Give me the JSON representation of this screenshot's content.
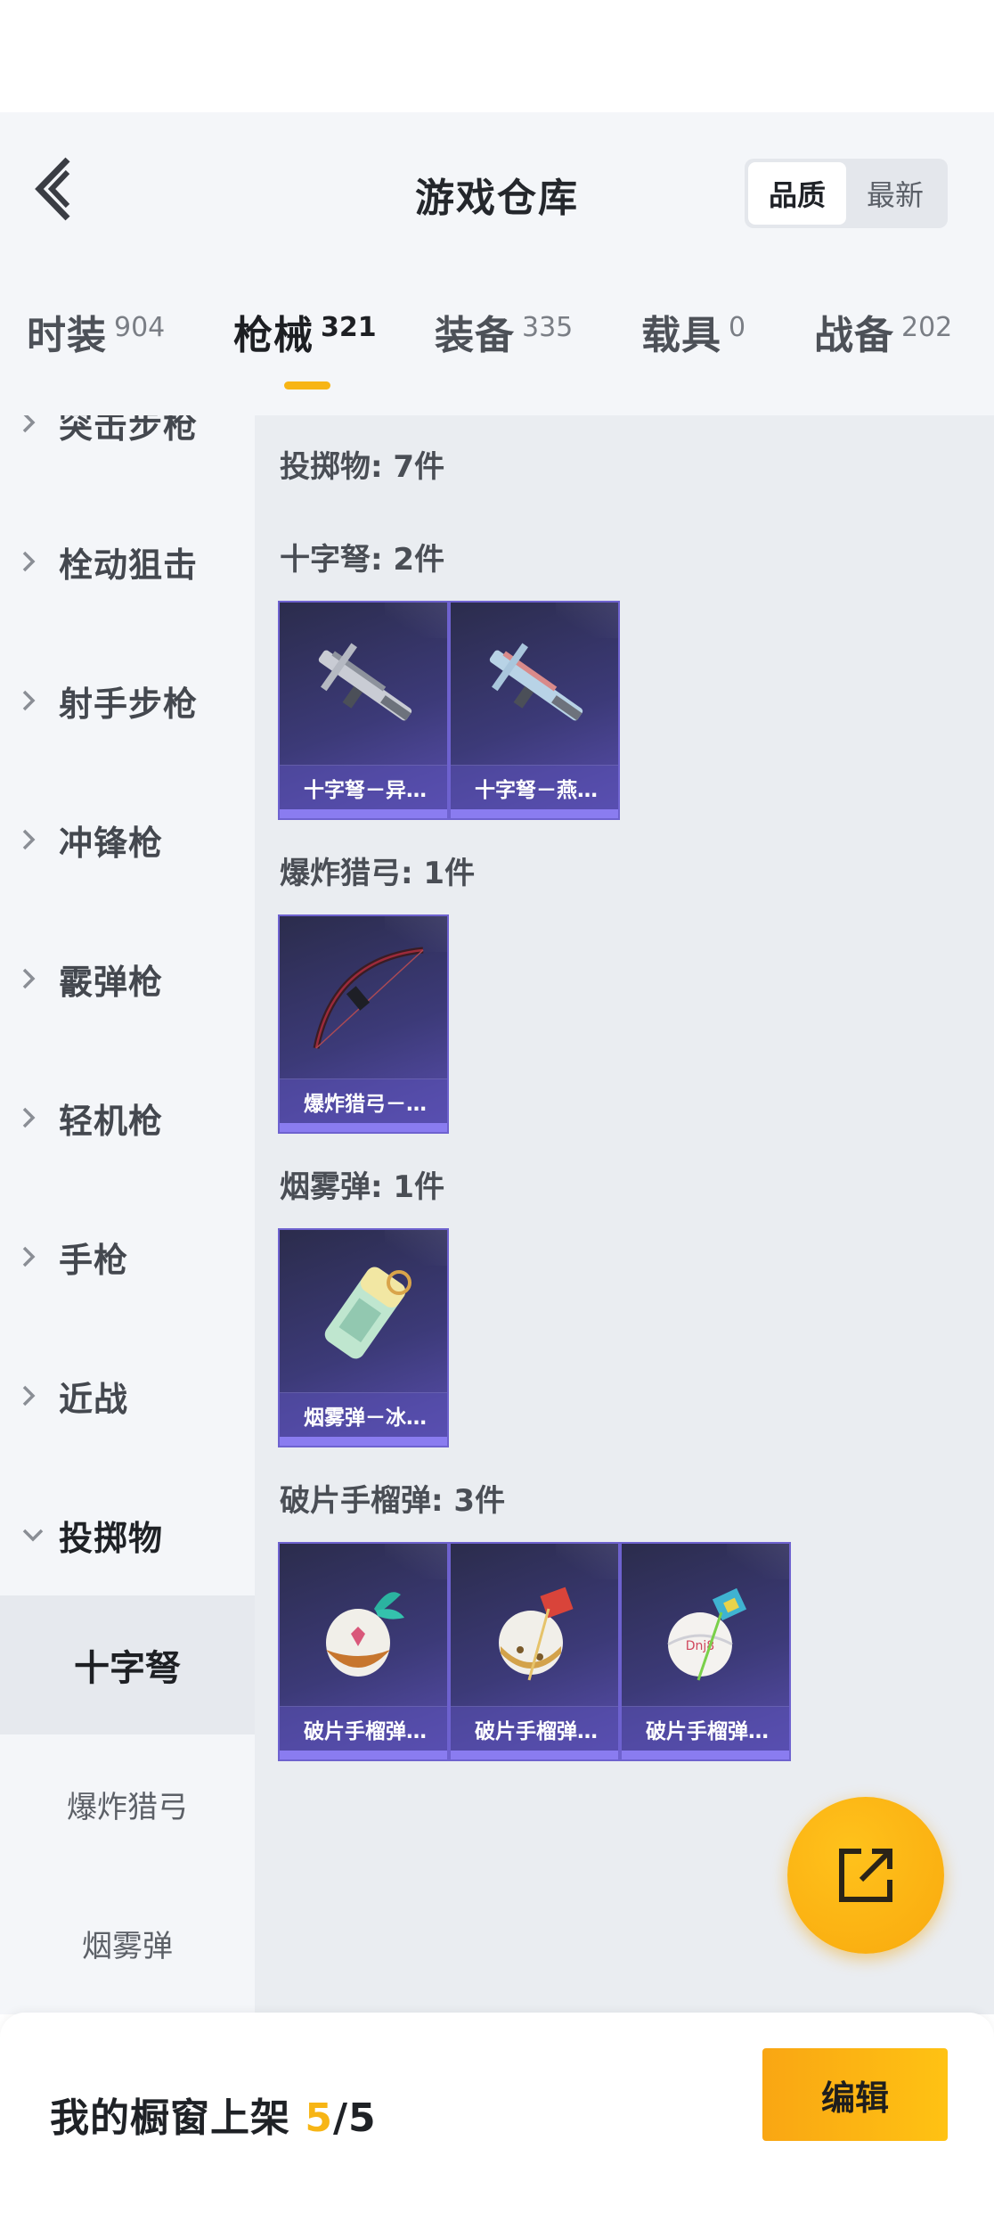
{
  "header": {
    "title": "游戏仓库",
    "sort": {
      "quality": "品质",
      "latest": "最新"
    }
  },
  "categories": [
    {
      "label": "时装",
      "count": "904"
    },
    {
      "label": "枪械",
      "count": "321"
    },
    {
      "label": "装备",
      "count": "335"
    },
    {
      "label": "载具",
      "count": "0"
    },
    {
      "label": "战备",
      "count": "202"
    }
  ],
  "sidebar": {
    "items": [
      {
        "label": "突击步枪"
      },
      {
        "label": "栓动狙击"
      },
      {
        "label": "射手步枪"
      },
      {
        "label": "冲锋枪"
      },
      {
        "label": "霰弹枪"
      },
      {
        "label": "轻机枪"
      },
      {
        "label": "手枪"
      },
      {
        "label": "近战"
      },
      {
        "label": "投掷物"
      }
    ],
    "subitems": [
      {
        "label": "十字弩"
      },
      {
        "label": "爆炸猎弓"
      },
      {
        "label": "烟雾弹"
      }
    ]
  },
  "content": {
    "summary": "投掷物: 7件",
    "groups": [
      {
        "title": "十字弩: 2件",
        "items": [
          "十字弩－异…",
          "十字弩－燕…"
        ]
      },
      {
        "title": "爆炸猎弓: 1件",
        "items": [
          "爆炸猎弓－…"
        ]
      },
      {
        "title": "烟雾弹: 1件",
        "items": [
          "烟雾弹－冰…"
        ]
      },
      {
        "title": "破片手榴弹: 3件",
        "items": [
          "破片手榴弹…",
          "破片手榴弹…",
          "破片手榴弹…"
        ]
      }
    ]
  },
  "footer": {
    "label": "我的橱窗上架",
    "current": "5",
    "total": "/5",
    "edit": "编辑"
  },
  "colors": {
    "accent": "#f7b515",
    "card": "#3c3a78"
  }
}
